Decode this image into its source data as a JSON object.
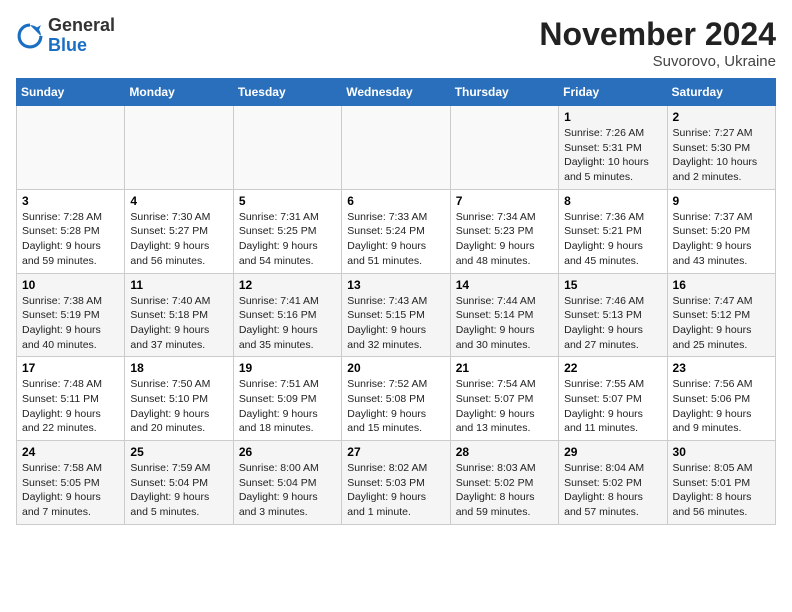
{
  "logo": {
    "general": "General",
    "blue": "Blue"
  },
  "header": {
    "month": "November 2024",
    "location": "Suvorovo, Ukraine"
  },
  "weekdays": [
    "Sunday",
    "Monday",
    "Tuesday",
    "Wednesday",
    "Thursday",
    "Friday",
    "Saturday"
  ],
  "weeks": [
    [
      {
        "day": "",
        "info": ""
      },
      {
        "day": "",
        "info": ""
      },
      {
        "day": "",
        "info": ""
      },
      {
        "day": "",
        "info": ""
      },
      {
        "day": "",
        "info": ""
      },
      {
        "day": "1",
        "info": "Sunrise: 7:26 AM\nSunset: 5:31 PM\nDaylight: 10 hours\nand 5 minutes."
      },
      {
        "day": "2",
        "info": "Sunrise: 7:27 AM\nSunset: 5:30 PM\nDaylight: 10 hours\nand 2 minutes."
      }
    ],
    [
      {
        "day": "3",
        "info": "Sunrise: 7:28 AM\nSunset: 5:28 PM\nDaylight: 9 hours\nand 59 minutes."
      },
      {
        "day": "4",
        "info": "Sunrise: 7:30 AM\nSunset: 5:27 PM\nDaylight: 9 hours\nand 56 minutes."
      },
      {
        "day": "5",
        "info": "Sunrise: 7:31 AM\nSunset: 5:25 PM\nDaylight: 9 hours\nand 54 minutes."
      },
      {
        "day": "6",
        "info": "Sunrise: 7:33 AM\nSunset: 5:24 PM\nDaylight: 9 hours\nand 51 minutes."
      },
      {
        "day": "7",
        "info": "Sunrise: 7:34 AM\nSunset: 5:23 PM\nDaylight: 9 hours\nand 48 minutes."
      },
      {
        "day": "8",
        "info": "Sunrise: 7:36 AM\nSunset: 5:21 PM\nDaylight: 9 hours\nand 45 minutes."
      },
      {
        "day": "9",
        "info": "Sunrise: 7:37 AM\nSunset: 5:20 PM\nDaylight: 9 hours\nand 43 minutes."
      }
    ],
    [
      {
        "day": "10",
        "info": "Sunrise: 7:38 AM\nSunset: 5:19 PM\nDaylight: 9 hours\nand 40 minutes."
      },
      {
        "day": "11",
        "info": "Sunrise: 7:40 AM\nSunset: 5:18 PM\nDaylight: 9 hours\nand 37 minutes."
      },
      {
        "day": "12",
        "info": "Sunrise: 7:41 AM\nSunset: 5:16 PM\nDaylight: 9 hours\nand 35 minutes."
      },
      {
        "day": "13",
        "info": "Sunrise: 7:43 AM\nSunset: 5:15 PM\nDaylight: 9 hours\nand 32 minutes."
      },
      {
        "day": "14",
        "info": "Sunrise: 7:44 AM\nSunset: 5:14 PM\nDaylight: 9 hours\nand 30 minutes."
      },
      {
        "day": "15",
        "info": "Sunrise: 7:46 AM\nSunset: 5:13 PM\nDaylight: 9 hours\nand 27 minutes."
      },
      {
        "day": "16",
        "info": "Sunrise: 7:47 AM\nSunset: 5:12 PM\nDaylight: 9 hours\nand 25 minutes."
      }
    ],
    [
      {
        "day": "17",
        "info": "Sunrise: 7:48 AM\nSunset: 5:11 PM\nDaylight: 9 hours\nand 22 minutes."
      },
      {
        "day": "18",
        "info": "Sunrise: 7:50 AM\nSunset: 5:10 PM\nDaylight: 9 hours\nand 20 minutes."
      },
      {
        "day": "19",
        "info": "Sunrise: 7:51 AM\nSunset: 5:09 PM\nDaylight: 9 hours\nand 18 minutes."
      },
      {
        "day": "20",
        "info": "Sunrise: 7:52 AM\nSunset: 5:08 PM\nDaylight: 9 hours\nand 15 minutes."
      },
      {
        "day": "21",
        "info": "Sunrise: 7:54 AM\nSunset: 5:07 PM\nDaylight: 9 hours\nand 13 minutes."
      },
      {
        "day": "22",
        "info": "Sunrise: 7:55 AM\nSunset: 5:07 PM\nDaylight: 9 hours\nand 11 minutes."
      },
      {
        "day": "23",
        "info": "Sunrise: 7:56 AM\nSunset: 5:06 PM\nDaylight: 9 hours\nand 9 minutes."
      }
    ],
    [
      {
        "day": "24",
        "info": "Sunrise: 7:58 AM\nSunset: 5:05 PM\nDaylight: 9 hours\nand 7 minutes."
      },
      {
        "day": "25",
        "info": "Sunrise: 7:59 AM\nSunset: 5:04 PM\nDaylight: 9 hours\nand 5 minutes."
      },
      {
        "day": "26",
        "info": "Sunrise: 8:00 AM\nSunset: 5:04 PM\nDaylight: 9 hours\nand 3 minutes."
      },
      {
        "day": "27",
        "info": "Sunrise: 8:02 AM\nSunset: 5:03 PM\nDaylight: 9 hours\nand 1 minute."
      },
      {
        "day": "28",
        "info": "Sunrise: 8:03 AM\nSunset: 5:02 PM\nDaylight: 8 hours\nand 59 minutes."
      },
      {
        "day": "29",
        "info": "Sunrise: 8:04 AM\nSunset: 5:02 PM\nDaylight: 8 hours\nand 57 minutes."
      },
      {
        "day": "30",
        "info": "Sunrise: 8:05 AM\nSunset: 5:01 PM\nDaylight: 8 hours\nand 56 minutes."
      }
    ]
  ]
}
